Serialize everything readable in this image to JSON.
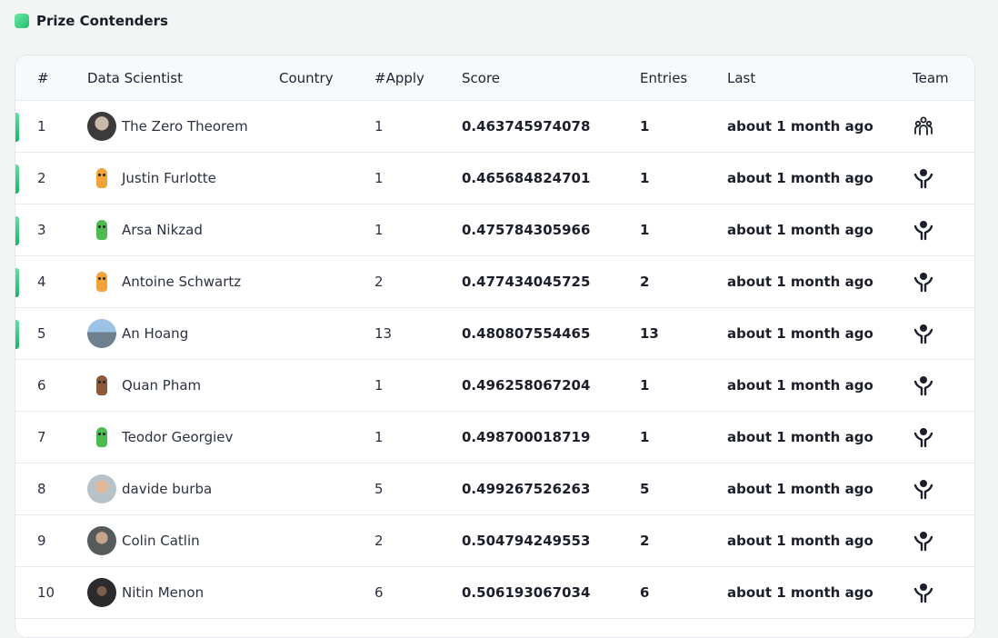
{
  "section": {
    "title": "Prize Contenders",
    "accent": "#1fbf6a"
  },
  "table": {
    "headers": {
      "rank": "#",
      "name": "Data Scientist",
      "country": "Country",
      "apply": "#Apply",
      "score": "Score",
      "entries": "Entries",
      "last": "Last",
      "team": "Team"
    },
    "rows": [
      {
        "rank": "1",
        "name": "The Zero Theorem",
        "country": "",
        "apply": "1",
        "score": "0.463745974078",
        "entries": "1",
        "last": "about 1 month ago",
        "team_icon": "team-group-icon",
        "prize": true,
        "avatar": "photo-dark"
      },
      {
        "rank": "2",
        "name": "Justin Furlotte",
        "country": "",
        "apply": "1",
        "score": "0.465684824701",
        "entries": "1",
        "last": "about 1 month ago",
        "team_icon": "solo-person-icon",
        "prize": true,
        "avatar": "sprite-orange"
      },
      {
        "rank": "3",
        "name": "Arsa Nikzad",
        "country": "",
        "apply": "1",
        "score": "0.475784305966",
        "entries": "1",
        "last": "about 1 month ago",
        "team_icon": "solo-person-icon",
        "prize": true,
        "avatar": "sprite-green"
      },
      {
        "rank": "4",
        "name": "Antoine Schwartz",
        "country": "",
        "apply": "2",
        "score": "0.477434045725",
        "entries": "2",
        "last": "about 1 month ago",
        "team_icon": "solo-person-icon",
        "prize": true,
        "avatar": "sprite-orange"
      },
      {
        "rank": "5",
        "name": "An Hoang",
        "country": "",
        "apply": "13",
        "score": "0.480807554465",
        "entries": "13",
        "last": "about 1 month ago",
        "team_icon": "solo-person-icon",
        "prize": true,
        "avatar": "photo-sky"
      },
      {
        "rank": "6",
        "name": "Quan Pham",
        "country": "",
        "apply": "1",
        "score": "0.496258067204",
        "entries": "1",
        "last": "about 1 month ago",
        "team_icon": "solo-person-icon",
        "prize": false,
        "avatar": "sprite-brown"
      },
      {
        "rank": "7",
        "name": "Teodor Georgiev",
        "country": "",
        "apply": "1",
        "score": "0.498700018719",
        "entries": "1",
        "last": "about 1 month ago",
        "team_icon": "solo-person-icon",
        "prize": false,
        "avatar": "sprite-green"
      },
      {
        "rank": "8",
        "name": "davide burba",
        "country": "",
        "apply": "5",
        "score": "0.499267526263",
        "entries": "5",
        "last": "about 1 month ago",
        "team_icon": "solo-person-icon",
        "prize": false,
        "avatar": "photo-face"
      },
      {
        "rank": "9",
        "name": "Colin Catlin",
        "country": "",
        "apply": "2",
        "score": "0.504794249553",
        "entries": "2",
        "last": "about 1 month ago",
        "team_icon": "solo-person-icon",
        "prize": false,
        "avatar": "photo-grey"
      },
      {
        "rank": "10",
        "name": "Nitin Menon",
        "country": "",
        "apply": "6",
        "score": "0.506193067034",
        "entries": "6",
        "last": "about 1 month ago",
        "team_icon": "solo-person-icon",
        "prize": false,
        "avatar": "photo-black"
      }
    ]
  }
}
